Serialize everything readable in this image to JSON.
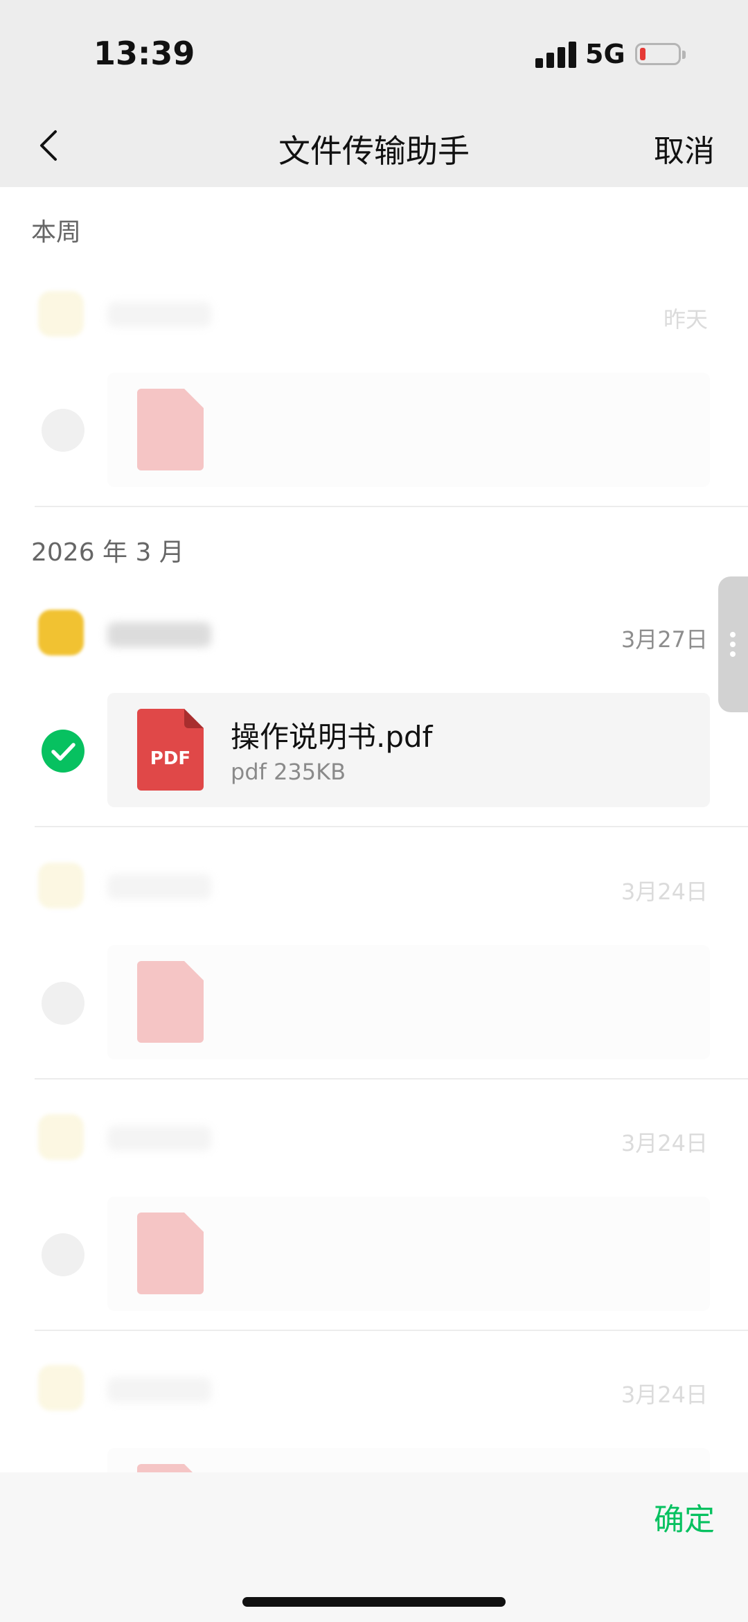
{
  "status_bar": {
    "time": "13:39",
    "network": "5G",
    "battery": "low"
  },
  "nav": {
    "back_icon": "chevron-left-icon",
    "title": "文件传输助手",
    "cancel": "取消"
  },
  "sections": {
    "this_week": "本周",
    "march": "2026 年 3 月"
  },
  "items": [
    {
      "date": "昨天",
      "file_name": "",
      "file_meta": "",
      "selected": false,
      "dimmed": true
    },
    {
      "date": "3月27日",
      "file_name": "操作说明书.pdf",
      "file_meta": "pdf 235KB",
      "file_badge": "PDF",
      "selected": true,
      "dimmed": false
    },
    {
      "date": "3月24日",
      "file_name": "",
      "file_meta": "",
      "selected": false,
      "dimmed": true
    },
    {
      "date": "3月24日",
      "file_name": "",
      "file_meta": "",
      "selected": false,
      "dimmed": true
    },
    {
      "date": "3月24日",
      "file_name": "",
      "file_meta": "",
      "selected": false,
      "dimmed": true
    }
  ],
  "bottom": {
    "confirm": "确定"
  },
  "colors": {
    "accent": "#07c160",
    "pdf_red": "#e04848",
    "nav_bg": "#ededed"
  }
}
